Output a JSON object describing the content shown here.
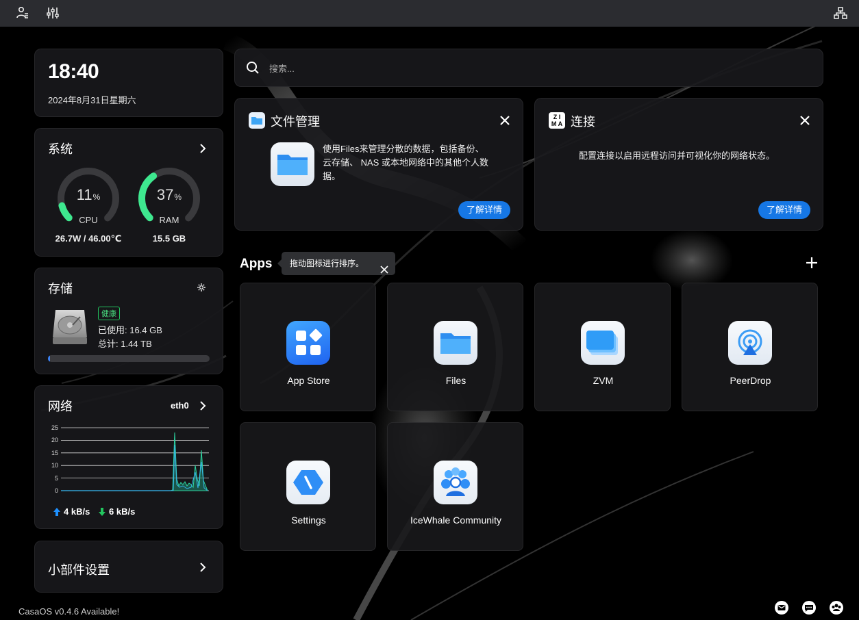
{
  "clock": {
    "time": "18:40",
    "date": "2024年8月31日星期六"
  },
  "system": {
    "title": "系统",
    "cpu": {
      "value": "11",
      "unit": "%",
      "label": "CPU",
      "percent": 11,
      "detail": "26.7W / 46.00℃"
    },
    "ram": {
      "value": "37",
      "unit": "%",
      "label": "RAM",
      "percent": 37,
      "detail": "15.5 GB"
    },
    "accent": "#3ee88f"
  },
  "storage": {
    "title": "存储",
    "health": "健康",
    "used": "已使用: 16.4 GB",
    "total": "总计: 1.44 TB",
    "used_fraction": 0.011
  },
  "network": {
    "title": "网络",
    "interface": "eth0",
    "y_ticks": [
      "25",
      "20",
      "15",
      "10",
      "5",
      "0"
    ],
    "upload": "4 kB/s",
    "download": "6 kB/s"
  },
  "widget_settings": {
    "title": "小部件设置"
  },
  "search": {
    "placeholder": "搜索..."
  },
  "files_card": {
    "title": "文件管理",
    "text": "使用Files来管理分散的数据，包括备份、 云存储、 NAS 或本地网络中的其他个人数据。",
    "button": "了解详情"
  },
  "connect_card": {
    "title": "连接",
    "text": "配置连接以启用远程访问并可视化你的网络状态。",
    "button": "了解详情"
  },
  "apps": {
    "title": "Apps",
    "tooltip": "拖动图标进行排序。",
    "items": [
      {
        "name": "App Store"
      },
      {
        "name": "Files"
      },
      {
        "name": "ZVM"
      },
      {
        "name": "PeerDrop"
      },
      {
        "name": "Settings"
      },
      {
        "name": "IceWhale Community"
      }
    ]
  },
  "footer": {
    "update": "CasaOS v0.4.6 Available!"
  }
}
